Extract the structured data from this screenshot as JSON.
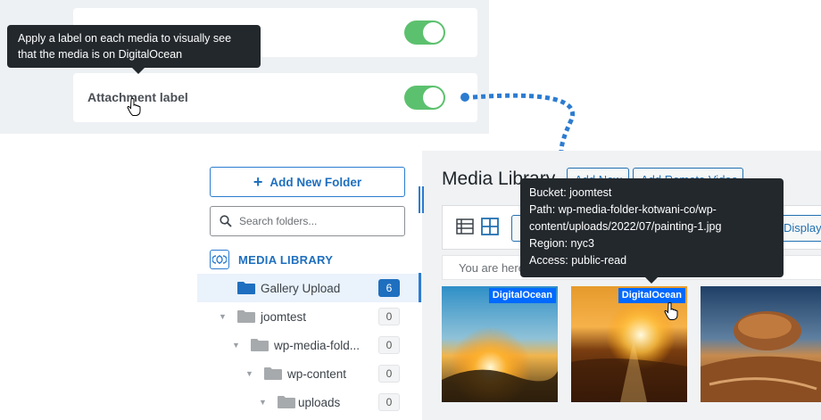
{
  "settings": {
    "tooltip": "Apply a label on each media to visually see that the media is on DigitalOcean",
    "attachment_label": "Attachment label",
    "accent_color": "#5cc16e",
    "toggle_1_on": true,
    "toggle_2_on": true
  },
  "sidebar": {
    "add_folder_label": "Add New Folder",
    "search_placeholder": "Search folders...",
    "library_label": "MEDIA LIBRARY",
    "folders": [
      {
        "name": "Gallery Upload",
        "count": "6",
        "active": true
      },
      {
        "name": "joomtest",
        "count": "0"
      },
      {
        "name": "wp-media-fold...",
        "count": "0"
      },
      {
        "name": "wp-content",
        "count": "0"
      },
      {
        "name": "uploads",
        "count": "0"
      }
    ]
  },
  "main": {
    "title": "Media Library",
    "add_new_label": "Add New",
    "add_remote_label": "Add Remote Video",
    "display_label": "Display all",
    "breadcrumb": "You are here",
    "badge_label": "DigitalOcean",
    "badge_color": "#0069ff"
  },
  "meta_tooltip": {
    "bucket": "Bucket: joomtest",
    "path": "Path: wp-media-folder-kotwani-co/wp-content/uploads/2022/07/painting-1.jpg",
    "region": "Region: nyc3",
    "access": "Access: public-read"
  },
  "icons": [
    "hand-cursor-icon",
    "plus-icon",
    "search-icon",
    "media-library-icon",
    "folder-icon",
    "list-view-icon",
    "grid-view-icon"
  ]
}
